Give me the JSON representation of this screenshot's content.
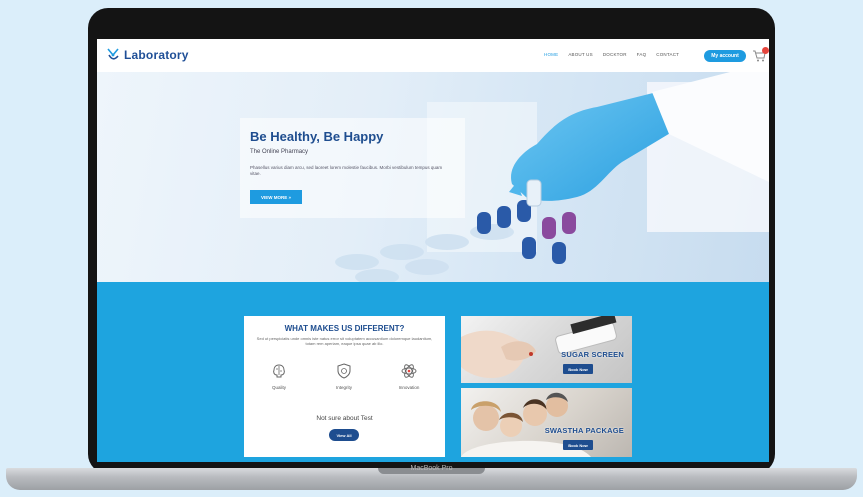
{
  "device": {
    "caption": "MacBook Pro"
  },
  "site": {
    "logo_text": "Laboratory"
  },
  "nav": {
    "items": [
      "HOME",
      "ABOUT US",
      "DOCKTOR",
      "FAQ",
      "CONTACT"
    ],
    "account_label": "My account",
    "active_color": "#1e9be0"
  },
  "hero": {
    "title": "Be Healthy, Be Happy",
    "subtitle": "The Online Pharmacy",
    "body": "Phasellus varius diam arcu, sed laoreet lorem molestie faucibus. Morbi vestibulum tempus quam vitae.",
    "button_label": "VIEW MORE »"
  },
  "features_card": {
    "title": "WHAT MAKES US DIFFERENT?",
    "text": "Sed ut perspiciatis unde omnis iste natus error sit voluptatem accusantium doloremque laudantium, totam rem aperiam, eaque ipsa quae ab illo.",
    "features": [
      {
        "icon": "brain-icon",
        "label": "Quality"
      },
      {
        "icon": "shield-icon",
        "label": "Integrity"
      },
      {
        "icon": "atom-icon",
        "label": "Innovation"
      }
    ],
    "prompt": "Not sure about Test",
    "button_label": "View All"
  },
  "promos": [
    {
      "title": "SUGAR SCREEN",
      "button_label": "Book Now"
    },
    {
      "title": "SWASTHA PACKAGE",
      "button_label": "Book Now"
    }
  ],
  "colors": {
    "brand_blue": "#1e9be0",
    "navy": "#1e4d8f",
    "section_blue": "#1ea4df",
    "badge_red": "#e5453d"
  }
}
